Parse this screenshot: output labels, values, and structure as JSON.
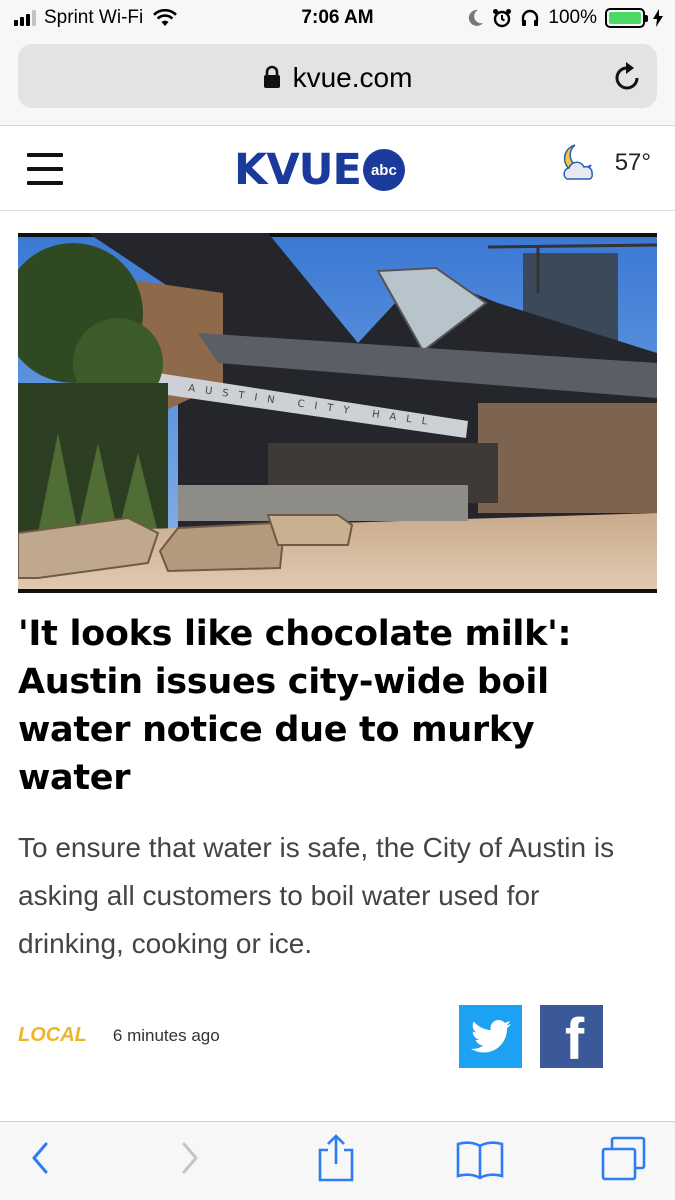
{
  "status_bar": {
    "carrier": "Sprint Wi-Fi",
    "time": "7:06 AM",
    "battery_percent": "100%",
    "battery_level": 1.0,
    "signal_bars_filled": 3,
    "signal_bars_total": 4
  },
  "browser": {
    "url": "kvue.com"
  },
  "site": {
    "logo_text": "KVUE",
    "network_badge": "abc",
    "weather_temp": "57°",
    "weather_icon": "moon-cloud-icon"
  },
  "article": {
    "headline": "'It looks like chocolate milk': Austin issues city-wide boil water notice due to murky water",
    "summary": "To ensure that water is safe, the City of Austin is asking all customers to boil water used for drinking, cooking or ice.",
    "category": "LOCAL",
    "time_ago": "6 minutes ago",
    "hero_sign_text": "AUSTIN CITY HALL"
  },
  "share": {
    "twitter_icon": "twitter-bird-icon",
    "facebook_icon": "facebook-f-icon",
    "facebook_letter": "f"
  },
  "colors": {
    "brand": "#1a3a9c",
    "category": "#f0b429",
    "twitter": "#1da1f2",
    "facebook": "#3b5998",
    "ios_blue": "#2d7cf6"
  }
}
